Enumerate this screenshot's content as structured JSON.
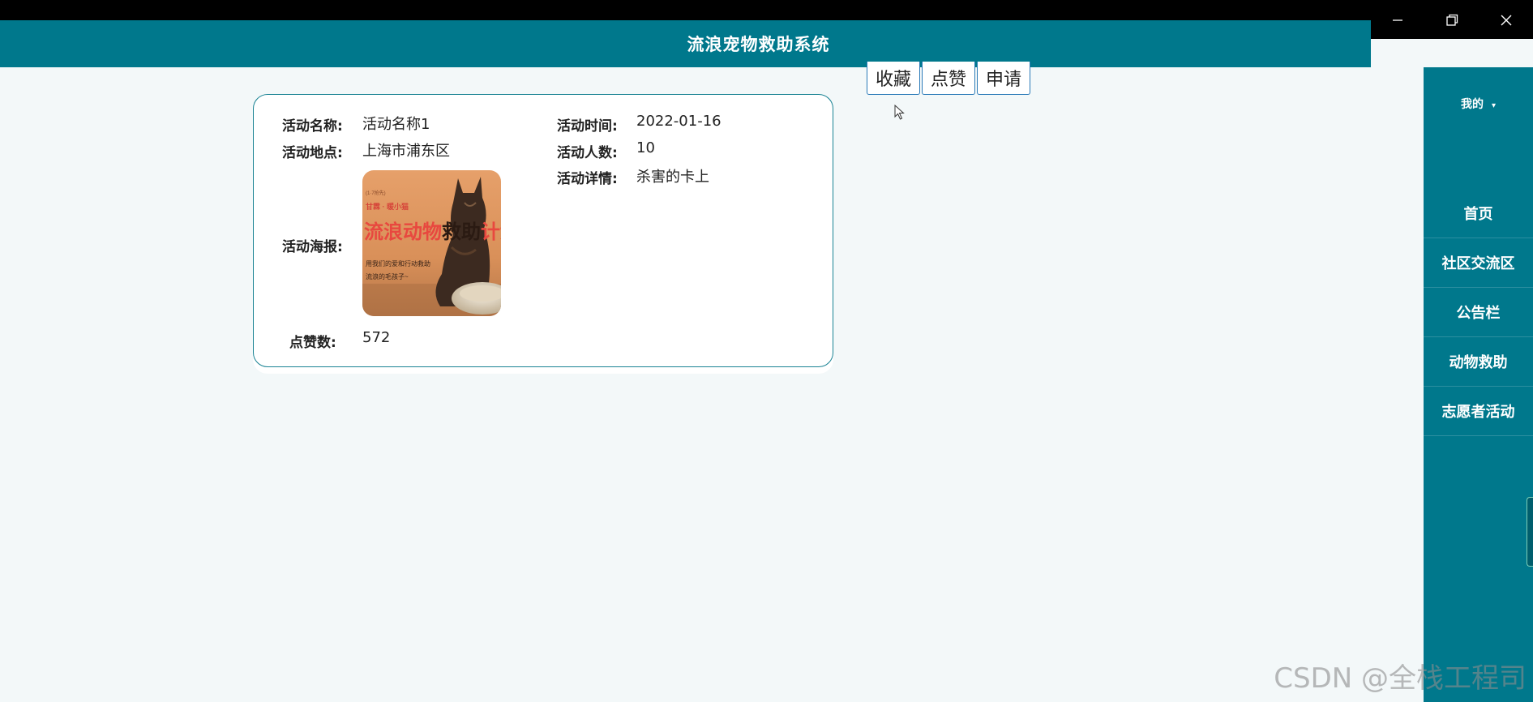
{
  "header": {
    "title": "流浪宠物救助系统"
  },
  "window_controls": [
    "minimize-icon",
    "restore-icon",
    "close-icon"
  ],
  "sidebar": {
    "my_label": "我的",
    "items": [
      {
        "label": "首页"
      },
      {
        "label": "社区交流区"
      },
      {
        "label": "公告栏"
      },
      {
        "label": "动物救助"
      },
      {
        "label": "志愿者活动"
      }
    ]
  },
  "actions": {
    "favorite": "收藏",
    "like": "点赞",
    "apply": "申请"
  },
  "detail": {
    "name_label": "活动名称:",
    "name_value": "活动名称1",
    "time_label": "活动时间:",
    "time_value": "2022-01-16",
    "location_label": "活动地点:",
    "location_value": "上海市浦东区",
    "people_label": "活动人数:",
    "people_value": "10",
    "details_label": "活动详情:",
    "details_value": "杀害的卡上",
    "poster_label": "活动海报:",
    "likes_label": "点赞数:",
    "likes_value": "572"
  },
  "poster": {
    "small_tag": "(1·7抢先)",
    "line1": "甘霖 · 暖小猫",
    "title_a": "流浪动物",
    "title_b": "救助",
    "title_c": "计划",
    "sub1": "用我们的爱和行动救助",
    "sub2": "流浪的毛孩子~"
  },
  "watermark": "CSDN @全栈工程司",
  "colors": {
    "primary": "#00788c",
    "background": "#f3f8f9",
    "border": "#1a8394"
  }
}
